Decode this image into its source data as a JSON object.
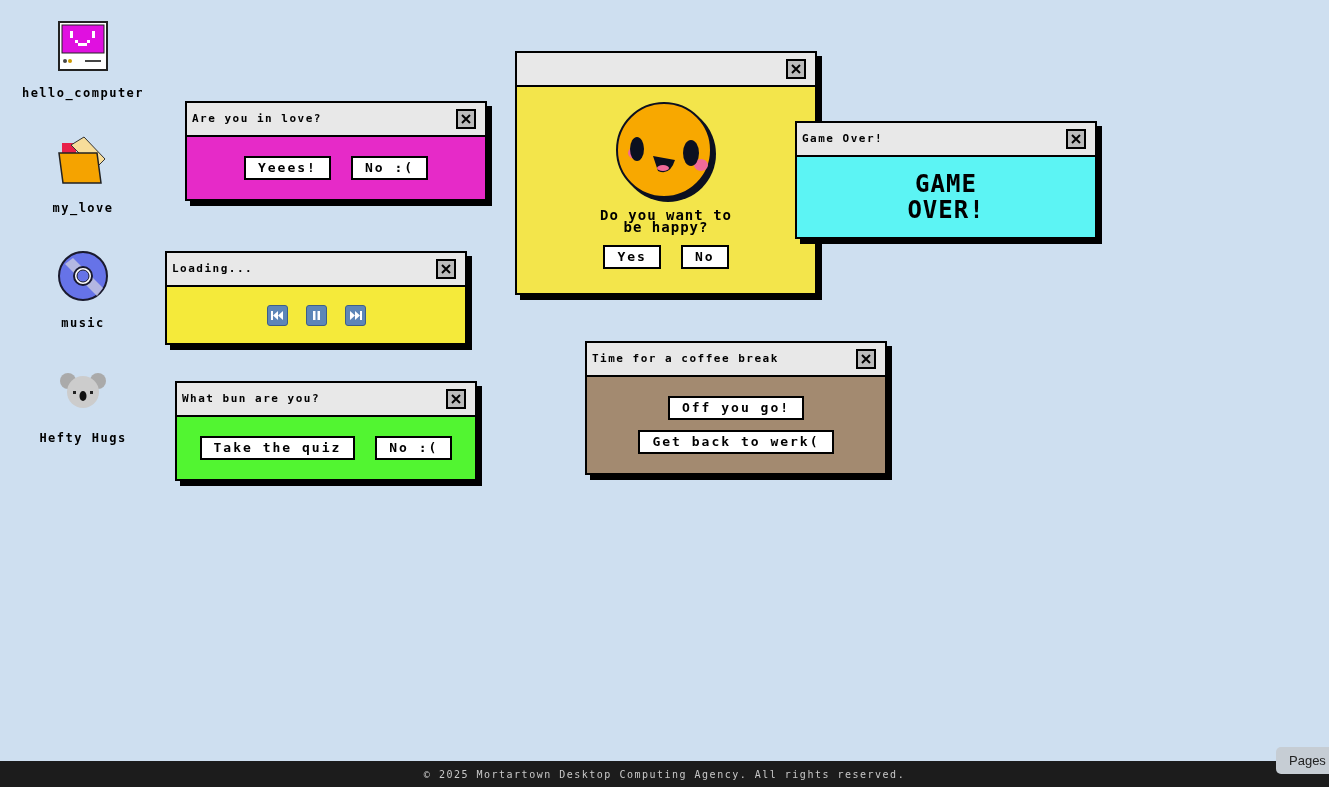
{
  "desktop_icons": [
    {
      "kind": "computer",
      "label": "hello_computer"
    },
    {
      "kind": "folder",
      "label": "my_love"
    },
    {
      "kind": "disc",
      "label": "music"
    },
    {
      "kind": "koala",
      "label": "Hefty Hugs"
    }
  ],
  "windows": [
    {
      "kind": "choice",
      "title": "Are you in love?",
      "color": "#e62ac8",
      "buttons": [
        "Yeees!",
        "No :("
      ]
    },
    {
      "kind": "player",
      "title": "Loading...",
      "color": "#f5ea3a"
    },
    {
      "kind": "choice",
      "title": "What bun are you?",
      "color": "#52f531",
      "buttons": [
        "Take the quiz",
        "No :("
      ]
    },
    {
      "kind": "smiley",
      "color": "#f3e54b",
      "message": "Do you want to be happy?",
      "buttons": [
        "Yes",
        "No"
      ]
    },
    {
      "kind": "message",
      "title": "Game Over!",
      "color": "#5cf4f4",
      "message": "GAME OVER!"
    },
    {
      "kind": "stacked",
      "title": "Time for a coffee break",
      "color": "#a38a70",
      "buttons": [
        "Off you go!",
        "Get back to werk("
      ]
    }
  ],
  "footer": {
    "text": "© 2025 Mortartown Desktop Computing Agency. All rights reserved."
  },
  "tooltip": {
    "text": "Pages"
  }
}
